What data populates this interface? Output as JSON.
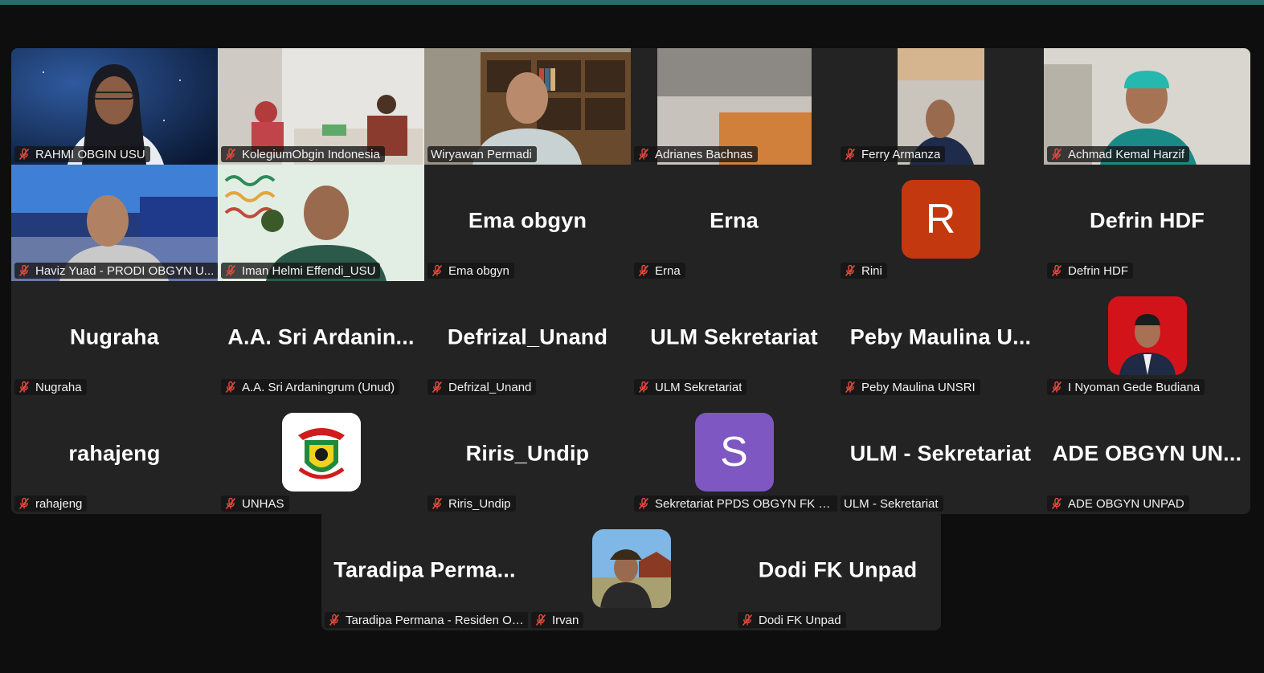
{
  "app": {
    "accent_color": "#2b6b6b",
    "active_speaker_color": "#2fd36b",
    "muted_icon": "mic-muted-icon"
  },
  "tiles": [
    {
      "name": "RAHMI OBGIN USU"
    },
    {
      "name": "KolegiumObgin Indonesia"
    },
    {
      "name": "Wiryawan Permadi",
      "active": true
    },
    {
      "name": "Adrianes Bachnas"
    },
    {
      "name": "Ferry Armanza"
    },
    {
      "name": "Achmad Kemal Harzif"
    },
    {
      "name": "Haviz Yuad - PRODI OBGYN U..."
    },
    {
      "name": "Iman Helmi Effendi_USU"
    },
    {
      "name": "Ema obgyn",
      "display": "Ema obgyn"
    },
    {
      "name": "Erna",
      "display": "Erna"
    },
    {
      "name": "Rini",
      "avatar_letter": "R",
      "avatar_color": "#c4380f"
    },
    {
      "name": "Defrin HDF",
      "display": "Defrin HDF"
    },
    {
      "name": "Nugraha",
      "display": "Nugraha"
    },
    {
      "name": "A.A. Sri Ardaningrum (Unud)",
      "display": "A.A.  Sri  Ardanin..."
    },
    {
      "name": "Defrizal_Unand",
      "display": "Defrizal_Unand"
    },
    {
      "name": "ULM Sekretariat",
      "display": "ULM Sekretariat"
    },
    {
      "name": "Peby Maulina UNSRI",
      "display": "Peby  Maulina  U..."
    },
    {
      "name": "I Nyoman Gede Budiana"
    },
    {
      "name": "rahajeng",
      "display": "rahajeng"
    },
    {
      "name": "UNHAS"
    },
    {
      "name": "Riris_Undip",
      "display": "Riris_Undip"
    },
    {
      "name": "Sekretariat PPDS OBGYN FK U...",
      "avatar_letter": "S",
      "avatar_color": "#7e57c2"
    },
    {
      "name": "ULM - Sekretariat",
      "display": "ULM - Sekretariat"
    },
    {
      "name": "ADE OBGYN UNPAD",
      "display": "ADE  OBGYN  UN..."
    },
    {
      "name": "Taradipa Permana - Residen Ob...",
      "display": "Taradipa  Perma..."
    },
    {
      "name": "Irvan"
    },
    {
      "name": "Dodi FK Unpad",
      "display": "Dodi FK Unpad"
    }
  ]
}
